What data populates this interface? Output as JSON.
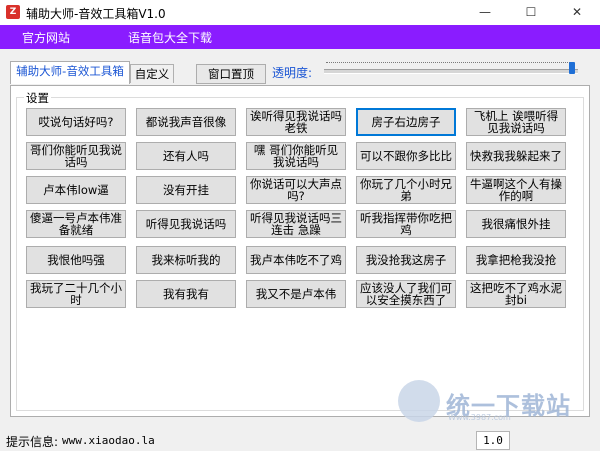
{
  "window": {
    "title": "辅助大师-音效工具箱V1.0",
    "icon_label": "Z",
    "minimize": "—",
    "maximize": "☐",
    "close": "✕"
  },
  "menu": {
    "items": [
      "官方网站",
      "语音包大全下载"
    ]
  },
  "tabs": [
    {
      "label": "辅助大师-音效工具箱",
      "active": true
    },
    {
      "label": "自定义",
      "active": false
    }
  ],
  "toolbar": {
    "window_top_button": "窗口置顶",
    "opacity_label": "透明度:",
    "opacity_value": 0.98
  },
  "settings": {
    "group_label": "设置",
    "buttons": [
      [
        "哎说句话好吗?",
        "都说我声音很像",
        "诶听得见我说话吗老铁",
        "房子右边房子",
        "飞机上 诶喂听得见我说话吗"
      ],
      [
        "哥们你能听见我说话吗",
        "还有人吗",
        "嘿 哥们你能听见我说话吗",
        "可以不跟你多比比",
        "快救我我躲起来了"
      ],
      [
        "卢本伟low逼",
        "没有开挂",
        "你说话可以大声点吗?",
        "你玩了几个小时兄弟",
        "牛逼啊这个人有操作的啊"
      ],
      [
        "傻逼一号卢本伟准备就绪",
        "听得见我说话吗",
        "听得见我说话吗三连击 急躁",
        "听我指挥带你吃把鸡",
        "我很痛恨外挂"
      ],
      [
        "我恨他吗强",
        "我来标听我的",
        "我卢本伟吃不了鸡",
        "我没抢我这房子",
        "我拿把枪我没抢"
      ],
      [
        "我玩了二十几个小时",
        "我有我有",
        "我又不是卢本伟",
        "应该没人了我们可以安全摸东西了",
        "这把吃不了鸡水泥封bi"
      ]
    ],
    "focused": [
      0,
      3
    ]
  },
  "status": {
    "label": "提示信息:",
    "text": "www.xiaodao.la",
    "version": "1.0"
  },
  "watermark": {
    "text": "统一下载站",
    "sub": "Www.3987.com"
  },
  "colors": {
    "menubar": "#8a1cff",
    "accent": "#1a55d4",
    "focus": "#0078d7"
  }
}
